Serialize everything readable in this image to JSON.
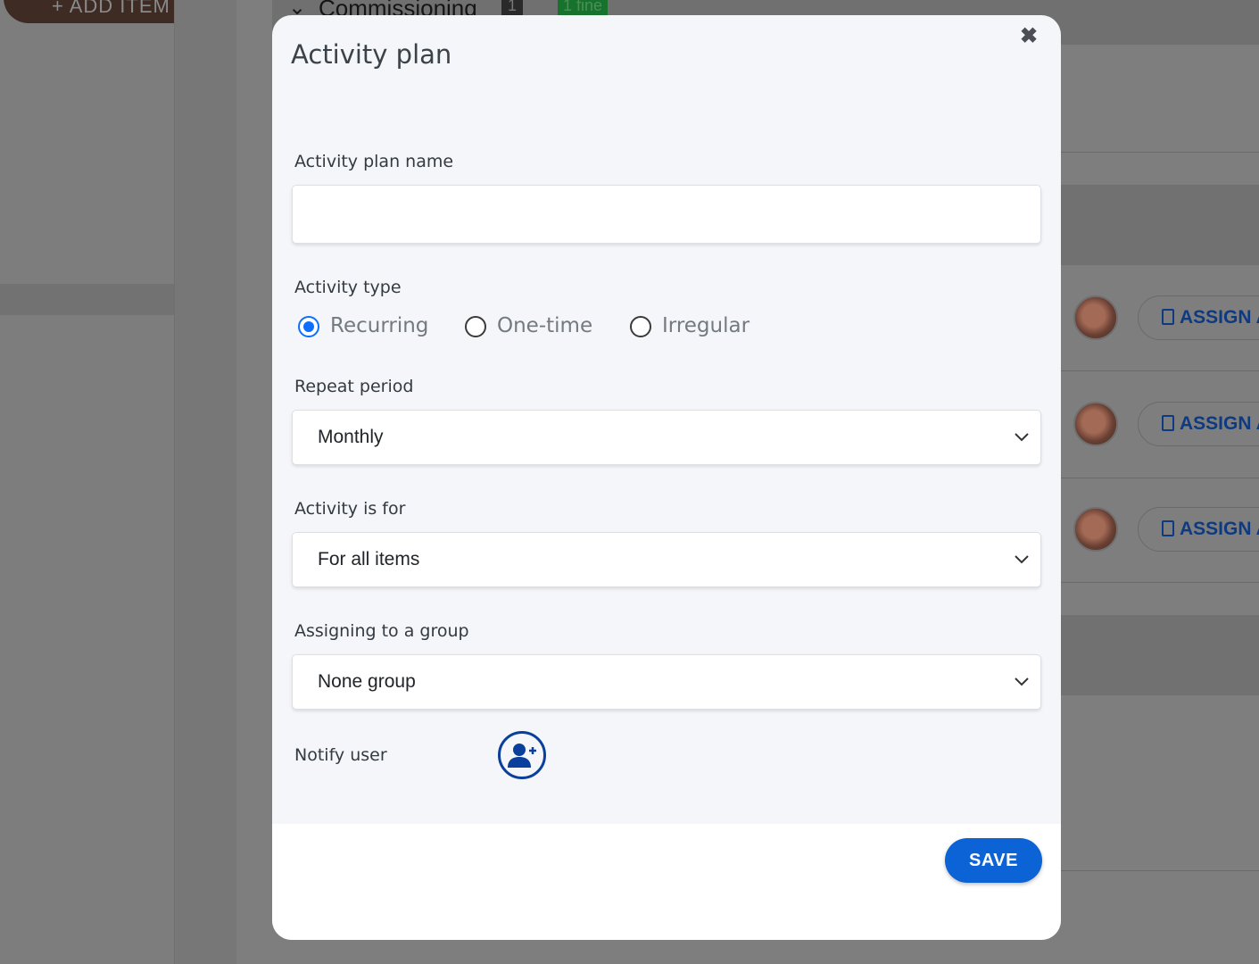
{
  "background": {
    "add_item_label": "+ ADD ITEM",
    "section_title": "Commissioning",
    "section_count": "1",
    "section_badge": "1 fine",
    "assign_label": "ASSIGN A",
    "rows": [
      {
        "avatar_icon": "user-photo-avatar",
        "assign_label": "ASSIGN A"
      },
      {
        "avatar_icon": "user-photo-avatar",
        "assign_label": "ASSIGN A"
      },
      {
        "avatar_icon": "user-photo-avatar",
        "assign_label": "ASSIGN A"
      }
    ]
  },
  "modal": {
    "title": "Activity plan",
    "close_icon": "close-icon",
    "fields": {
      "plan_name_label": "Activity plan name",
      "plan_name_value": "",
      "activity_type_label": "Activity type",
      "activity_type_options": [
        "Recurring",
        "One-time",
        "Irregular"
      ],
      "activity_type_selected": "Recurring",
      "repeat_period_label": "Repeat period",
      "repeat_period_value": "Monthly",
      "activity_for_label": "Activity is for",
      "activity_for_value": "For all items",
      "group_label": "Assigning to a group",
      "group_value": "None group",
      "notify_label": "Notify user",
      "notify_icon": "add-user-icon"
    },
    "save_label": "SAVE"
  },
  "colors": {
    "accent": "#0b63d6",
    "radio_checked": "#0d6efd",
    "icon_blue": "#0a3f9c",
    "overlay": "#7c7c7c",
    "modal_bg": "#f5f6f9"
  }
}
